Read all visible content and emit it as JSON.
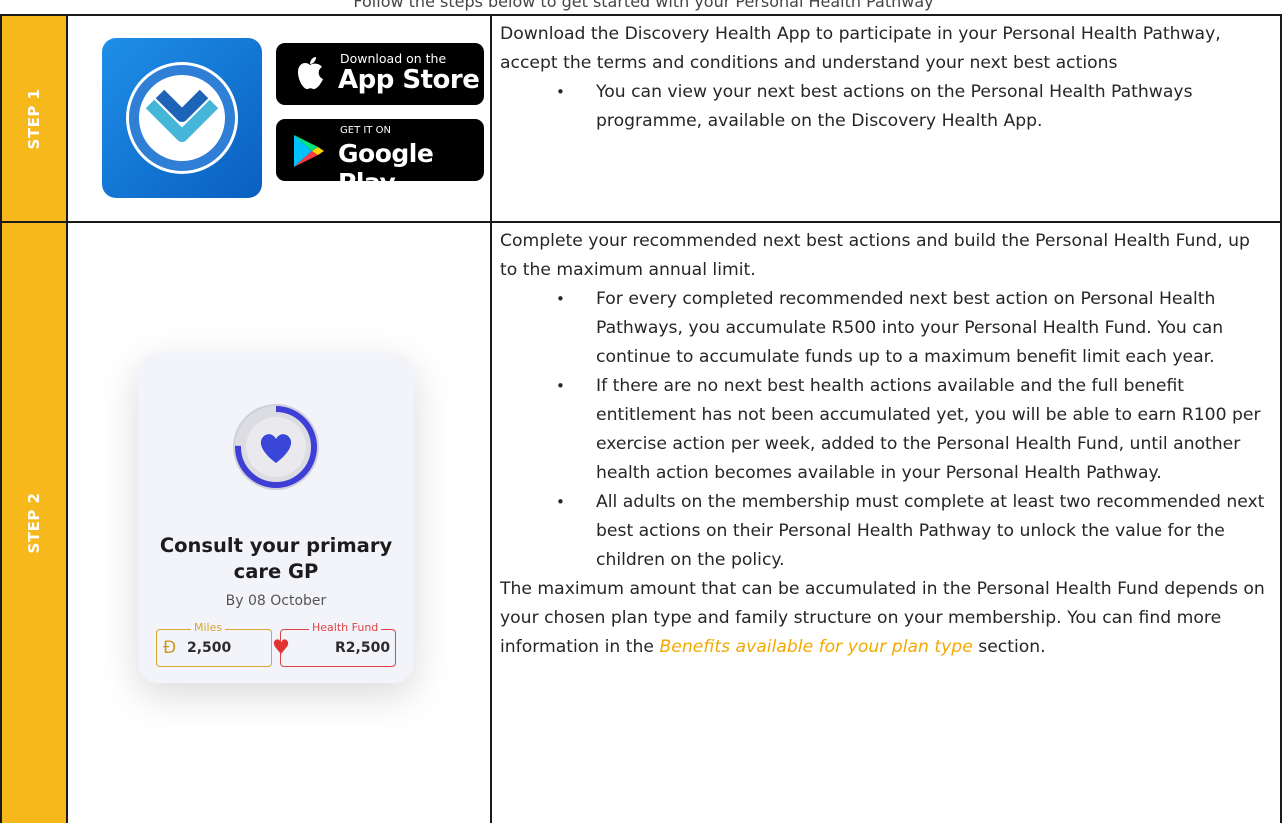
{
  "header": {
    "partial_text": "Follow the steps below to get started with your Personal Health Pathway"
  },
  "step1": {
    "label": "STEP 1",
    "app_icon": "discovery-app-icon",
    "app_store": {
      "small": "Download on the",
      "big": "App Store",
      "icon": "apple-icon"
    },
    "google_play": {
      "small": "GET IT ON",
      "big": "Google Play",
      "icon": "play-triangle-icon"
    },
    "intro": "Download the Discovery Health App to participate in your Personal Health Pathway, accept the terms and conditions and understand your next best actions",
    "bullets": [
      "You can view your next best actions on the Personal Health Pathways programme, available on the Discovery Health App."
    ]
  },
  "step2": {
    "label": "STEP 2",
    "card": {
      "title": "Consult your primary care GP",
      "date": "By 08 October",
      "miles_label": "Miles",
      "miles_value": "2,500",
      "fund_label": "Health Fund",
      "fund_value": "R2,500"
    },
    "intro": "Complete your recommended next best actions and build the Personal Health Fund, up to the maximum annual limit.",
    "bullets": [
      "For every completed recommended next best action on Personal Health Pathways, you accumulate R500 into your Personal Health Fund. You can continue to accumulate funds up to a maximum benefit limit each year.",
      "If there are no next best health actions available and the full benefit entitlement has not been accumulated yet, you will be able to earn R100 per exercise action per week, added to the Personal Health Fund, until another health action becomes available in your Personal Health Pathway.",
      "All adults on the membership must complete at least two recommended next best actions on their Personal Health Pathway to unlock the value for the children on the policy."
    ],
    "outro_before": "The maximum amount that can be accumulated in the Personal Health Fund depends on your chosen plan type and family structure on your membership. You can find more information in the ",
    "outro_link": "Benefits available for your plan type",
    "outro_after": " section."
  },
  "colors": {
    "step_label_bg": "#f7b81b",
    "link": "#f2a900",
    "app_blue": "#0a5fc0"
  }
}
